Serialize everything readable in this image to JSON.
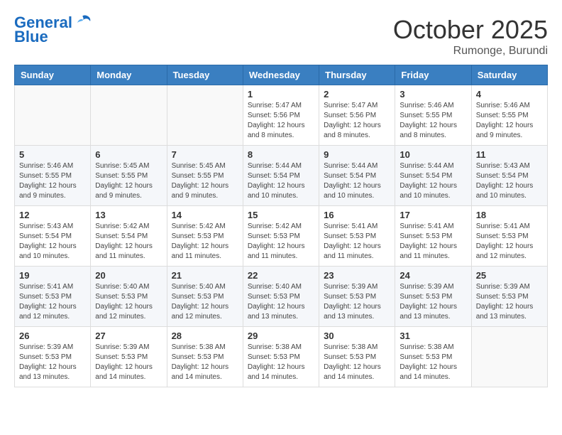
{
  "header": {
    "logo_line1": "General",
    "logo_line2": "Blue",
    "month": "October 2025",
    "location": "Rumonge, Burundi"
  },
  "weekdays": [
    "Sunday",
    "Monday",
    "Tuesday",
    "Wednesday",
    "Thursday",
    "Friday",
    "Saturday"
  ],
  "weeks": [
    [
      {
        "day": "",
        "info": ""
      },
      {
        "day": "",
        "info": ""
      },
      {
        "day": "",
        "info": ""
      },
      {
        "day": "1",
        "info": "Sunrise: 5:47 AM\nSunset: 5:56 PM\nDaylight: 12 hours\nand 8 minutes."
      },
      {
        "day": "2",
        "info": "Sunrise: 5:47 AM\nSunset: 5:56 PM\nDaylight: 12 hours\nand 8 minutes."
      },
      {
        "day": "3",
        "info": "Sunrise: 5:46 AM\nSunset: 5:55 PM\nDaylight: 12 hours\nand 8 minutes."
      },
      {
        "day": "4",
        "info": "Sunrise: 5:46 AM\nSunset: 5:55 PM\nDaylight: 12 hours\nand 9 minutes."
      }
    ],
    [
      {
        "day": "5",
        "info": "Sunrise: 5:46 AM\nSunset: 5:55 PM\nDaylight: 12 hours\nand 9 minutes."
      },
      {
        "day": "6",
        "info": "Sunrise: 5:45 AM\nSunset: 5:55 PM\nDaylight: 12 hours\nand 9 minutes."
      },
      {
        "day": "7",
        "info": "Sunrise: 5:45 AM\nSunset: 5:55 PM\nDaylight: 12 hours\nand 9 minutes."
      },
      {
        "day": "8",
        "info": "Sunrise: 5:44 AM\nSunset: 5:54 PM\nDaylight: 12 hours\nand 10 minutes."
      },
      {
        "day": "9",
        "info": "Sunrise: 5:44 AM\nSunset: 5:54 PM\nDaylight: 12 hours\nand 10 minutes."
      },
      {
        "day": "10",
        "info": "Sunrise: 5:44 AM\nSunset: 5:54 PM\nDaylight: 12 hours\nand 10 minutes."
      },
      {
        "day": "11",
        "info": "Sunrise: 5:43 AM\nSunset: 5:54 PM\nDaylight: 12 hours\nand 10 minutes."
      }
    ],
    [
      {
        "day": "12",
        "info": "Sunrise: 5:43 AM\nSunset: 5:54 PM\nDaylight: 12 hours\nand 10 minutes."
      },
      {
        "day": "13",
        "info": "Sunrise: 5:42 AM\nSunset: 5:54 PM\nDaylight: 12 hours\nand 11 minutes."
      },
      {
        "day": "14",
        "info": "Sunrise: 5:42 AM\nSunset: 5:53 PM\nDaylight: 12 hours\nand 11 minutes."
      },
      {
        "day": "15",
        "info": "Sunrise: 5:42 AM\nSunset: 5:53 PM\nDaylight: 12 hours\nand 11 minutes."
      },
      {
        "day": "16",
        "info": "Sunrise: 5:41 AM\nSunset: 5:53 PM\nDaylight: 12 hours\nand 11 minutes."
      },
      {
        "day": "17",
        "info": "Sunrise: 5:41 AM\nSunset: 5:53 PM\nDaylight: 12 hours\nand 11 minutes."
      },
      {
        "day": "18",
        "info": "Sunrise: 5:41 AM\nSunset: 5:53 PM\nDaylight: 12 hours\nand 12 minutes."
      }
    ],
    [
      {
        "day": "19",
        "info": "Sunrise: 5:41 AM\nSunset: 5:53 PM\nDaylight: 12 hours\nand 12 minutes."
      },
      {
        "day": "20",
        "info": "Sunrise: 5:40 AM\nSunset: 5:53 PM\nDaylight: 12 hours\nand 12 minutes."
      },
      {
        "day": "21",
        "info": "Sunrise: 5:40 AM\nSunset: 5:53 PM\nDaylight: 12 hours\nand 12 minutes."
      },
      {
        "day": "22",
        "info": "Sunrise: 5:40 AM\nSunset: 5:53 PM\nDaylight: 12 hours\nand 13 minutes."
      },
      {
        "day": "23",
        "info": "Sunrise: 5:39 AM\nSunset: 5:53 PM\nDaylight: 12 hours\nand 13 minutes."
      },
      {
        "day": "24",
        "info": "Sunrise: 5:39 AM\nSunset: 5:53 PM\nDaylight: 12 hours\nand 13 minutes."
      },
      {
        "day": "25",
        "info": "Sunrise: 5:39 AM\nSunset: 5:53 PM\nDaylight: 12 hours\nand 13 minutes."
      }
    ],
    [
      {
        "day": "26",
        "info": "Sunrise: 5:39 AM\nSunset: 5:53 PM\nDaylight: 12 hours\nand 13 minutes."
      },
      {
        "day": "27",
        "info": "Sunrise: 5:39 AM\nSunset: 5:53 PM\nDaylight: 12 hours\nand 14 minutes."
      },
      {
        "day": "28",
        "info": "Sunrise: 5:38 AM\nSunset: 5:53 PM\nDaylight: 12 hours\nand 14 minutes."
      },
      {
        "day": "29",
        "info": "Sunrise: 5:38 AM\nSunset: 5:53 PM\nDaylight: 12 hours\nand 14 minutes."
      },
      {
        "day": "30",
        "info": "Sunrise: 5:38 AM\nSunset: 5:53 PM\nDaylight: 12 hours\nand 14 minutes."
      },
      {
        "day": "31",
        "info": "Sunrise: 5:38 AM\nSunset: 5:53 PM\nDaylight: 12 hours\nand 14 minutes."
      },
      {
        "day": "",
        "info": ""
      }
    ]
  ]
}
